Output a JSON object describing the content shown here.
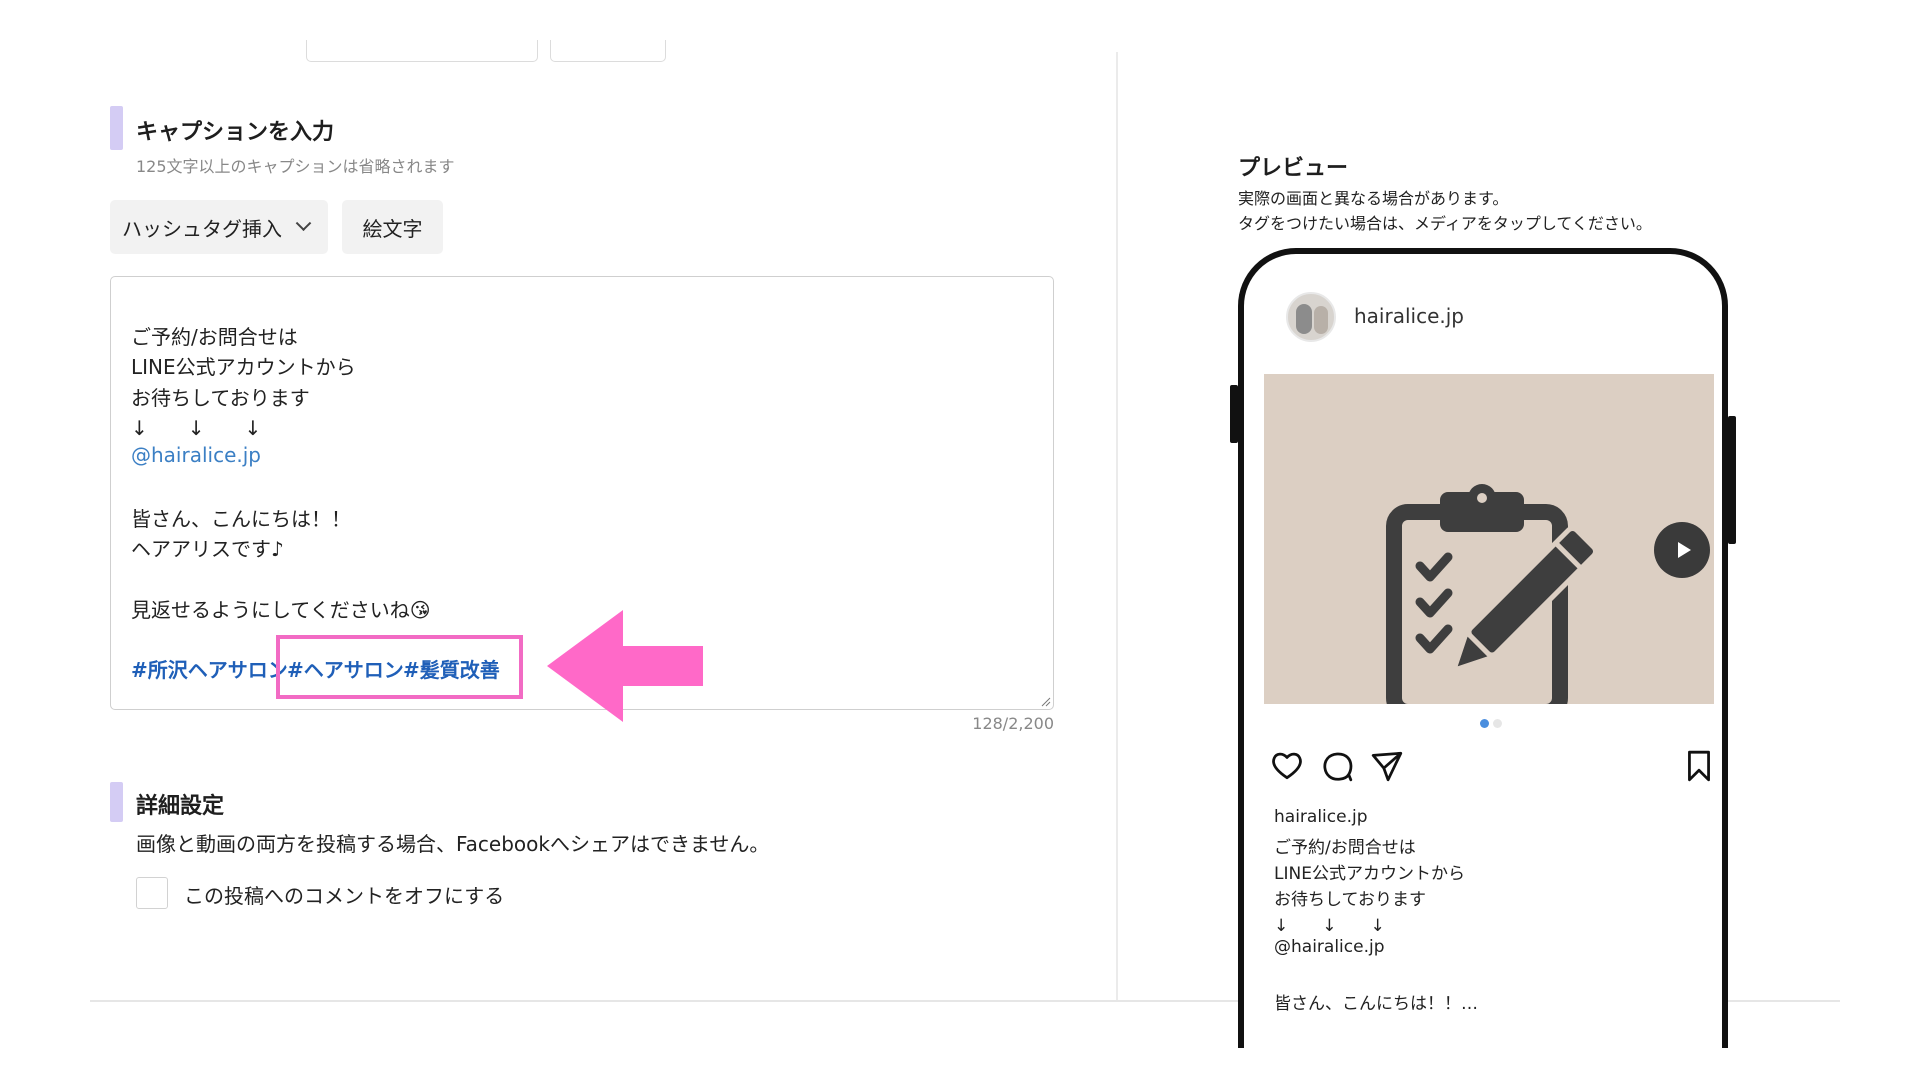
{
  "caption_section": {
    "title": "キャプションを入力",
    "subtitle": "125文字以上のキャプションは省略されます",
    "hashtag_button": "ハッシュタグ挿入",
    "emoji_button": "絵文字",
    "lines": [
      "ご予約/お問合せは",
      "LINE公式アカウントから",
      "お待ちしております",
      "↓　　↓　　↓",
      "@hairalice.jp",
      "",
      "皆さん、こんにちは！！",
      "ヘアアリスです♪",
      "",
      "見返せるようにしてくださいね😘"
    ],
    "hashtags": [
      "#所沢ヘアサロン",
      "#ヘアサロン",
      "#髪質改善"
    ],
    "counter": "128/2,200"
  },
  "detail_section": {
    "title": "詳細設定",
    "note": "画像と動画の両方を投稿する場合、Facebookへシェアはできません。",
    "comment_off_label": "この投稿へのコメントをオフにする"
  },
  "preview": {
    "title": "プレビュー",
    "note1": "実際の画面と異なる場合があります。",
    "note2": "タグをつけたい場合は、メディアをタップしてください。",
    "username": "hairalice.jp",
    "post_lines": [
      "hairalice.jp",
      "ご予約/お問合せは",
      "LINE公式アカウントから",
      "お待ちしております",
      "↓　　↓　　↓",
      "@hairalice.jp",
      "",
      "皆さん、こんにちは！！…"
    ]
  },
  "colors": {
    "accent_bar": "#d4ccf4",
    "hashtag": "#1f5fb8",
    "link": "#3b7fc4",
    "highlight": "#f26bc4",
    "media_bg": "#dccfc3",
    "dot_active": "#4a8ede"
  },
  "icons": [
    "chevron-down-icon",
    "heart-icon",
    "comment-icon",
    "send-icon",
    "bookmark-icon",
    "play-icon",
    "clipboard-pen-icon",
    "arrow-left-icon"
  ]
}
